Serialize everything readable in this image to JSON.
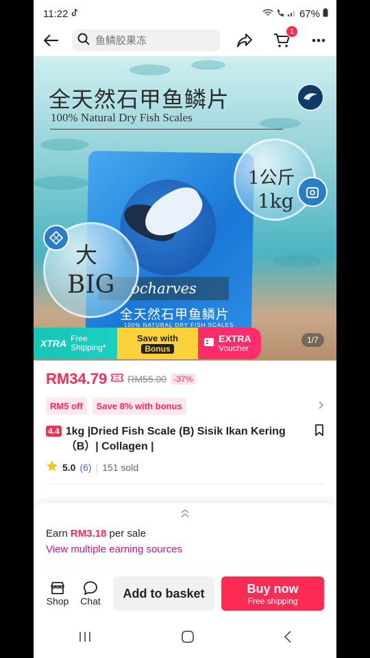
{
  "status": {
    "time": "11:22",
    "battery": "67%"
  },
  "search": {
    "placeholder": "鱼鳞胶果冻"
  },
  "cart": {
    "count": "1"
  },
  "hero": {
    "title_zh": "全天然石甲鱼鳞片",
    "title_en": "100% Natural Dry Fish Scales",
    "weight_zh": "1公斤",
    "weight_en": "1kg",
    "size_zh": "大",
    "size_en": "BIG",
    "brand": "ocharves",
    "bag_zh": "全天然石甲鱼鳞片",
    "bag_en": "100% NATURAL DRY FISH SCALES",
    "page_indicator": "1/7"
  },
  "promo": {
    "xtra": "XTRA",
    "free_shipping": "Free Shipping*",
    "save_with": "Save with",
    "bonus": "Bonus",
    "extra": "EXTRA",
    "voucher": "Voucher"
  },
  "price": {
    "current": "RM34.79",
    "original": "RM55.00",
    "discount": "-37%"
  },
  "chips": [
    "RM5 off",
    "Save 8% with bonus"
  ],
  "product": {
    "rating_tag": "4.4",
    "title": "1kg |Dried Fish Scale (B) Sisik Ikan Kering（B）| Collagen |",
    "score": "5.0",
    "reviews": "(6)",
    "sold": "151 sold"
  },
  "earn": {
    "prefix": "Earn ",
    "amount": "RM3.18",
    "suffix": " per sale",
    "link": "View multiple earning sources"
  },
  "actions": {
    "shop": "Shop",
    "chat": "Chat",
    "basket": "Add to basket",
    "buy": "Buy now",
    "buy_sub": "Free shipping"
  },
  "colors": {
    "accent": "#fe2c55",
    "teal": "#16c5b5",
    "yellow": "#fbd23a"
  }
}
